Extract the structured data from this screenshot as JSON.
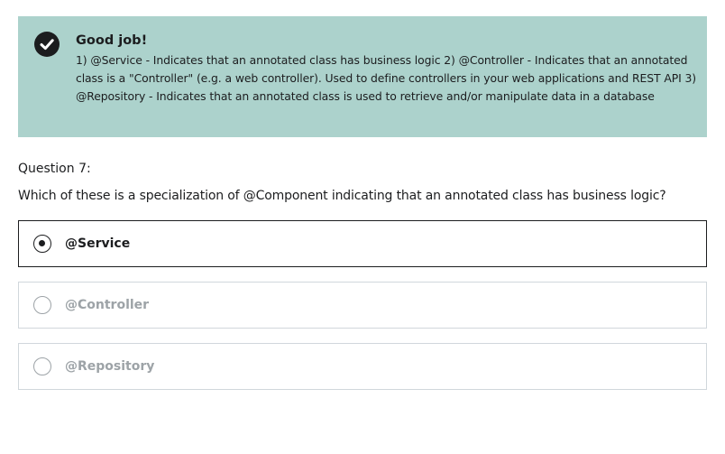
{
  "alert": {
    "icon": "check-circle-icon",
    "title": "Good job!",
    "body": "1) @Service - Indicates that an annotated class has business logic 2) @Controller - Indicates that an annotated class is a \"Controller\" (e.g. a web controller). Used to define controllers in your web applications and REST API 3) @Repository - Indicates that an annotated class is used to retrieve and/or manipulate data in a database",
    "background_color": "#acd2cc"
  },
  "question": {
    "number_label": "Question 7:",
    "text": "Which of these is a specialization of @Component indicating that an annotated class has business logic?"
  },
  "options": [
    {
      "label": "@Service",
      "selected": true
    },
    {
      "label": "@Controller",
      "selected": false
    },
    {
      "label": "@Repository",
      "selected": false
    }
  ],
  "colors": {
    "text": "#1c1d1f",
    "muted_text": "#9da3a7",
    "border": "#d1d7dc"
  }
}
